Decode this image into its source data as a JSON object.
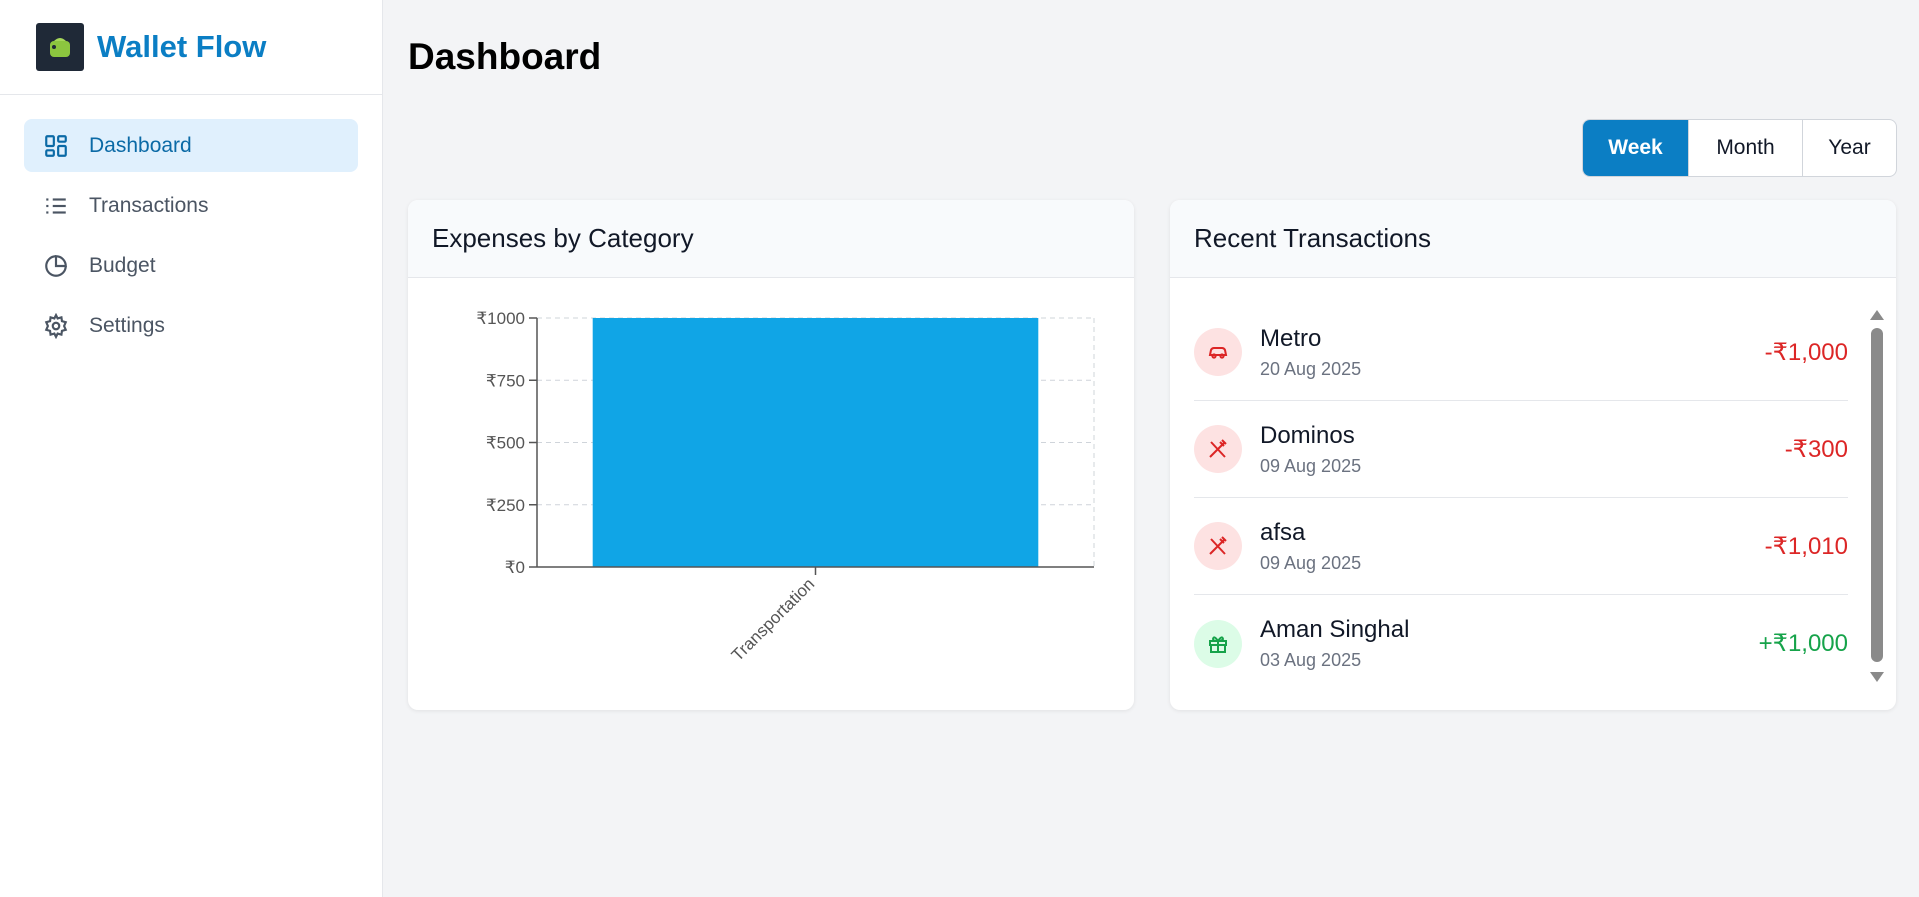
{
  "app": {
    "name": "Wallet Flow",
    "logo_icon": "wallet-icon"
  },
  "sidebar": {
    "items": [
      {
        "label": "Dashboard",
        "icon": "dashboard-grid-icon",
        "active": true
      },
      {
        "label": "Transactions",
        "icon": "list-icon",
        "active": false
      },
      {
        "label": "Budget",
        "icon": "pie-chart-icon",
        "active": false
      },
      {
        "label": "Settings",
        "icon": "gear-icon",
        "active": false
      }
    ]
  },
  "header": {
    "title": "Dashboard"
  },
  "period": {
    "options": [
      "Week",
      "Month",
      "Year"
    ],
    "selected": "Week"
  },
  "expenses": {
    "title": "Expenses by Category"
  },
  "chart_data": {
    "type": "bar",
    "categories": [
      "Transportation"
    ],
    "values": [
      1000
    ],
    "ylim": [
      0,
      1000
    ],
    "yticks": [
      "₹0",
      "₹250",
      "₹500",
      "₹750",
      "₹1000"
    ],
    "ytick_values": [
      0,
      250,
      500,
      750,
      1000
    ],
    "grid": true,
    "bar_color": "#10a5e6"
  },
  "recent": {
    "title": "Recent Transactions",
    "items": [
      {
        "name": "Metro",
        "date": "20 Aug 2025",
        "amount": "-₹1,000",
        "type": "expense",
        "icon": "car-icon"
      },
      {
        "name": "Dominos",
        "date": "09 Aug 2025",
        "amount": "-₹300",
        "type": "expense",
        "icon": "utensils-crossed-icon"
      },
      {
        "name": "afsa",
        "date": "09 Aug 2025",
        "amount": "-₹1,010",
        "type": "expense",
        "icon": "utensils-crossed-icon"
      },
      {
        "name": "Aman Singhal",
        "date": "03 Aug 2025",
        "amount": "+₹1,000",
        "type": "income",
        "icon": "gift-icon"
      }
    ]
  },
  "colors": {
    "accent": "#0b7ec4",
    "expense": "#dc2626",
    "income": "#16a34a"
  }
}
